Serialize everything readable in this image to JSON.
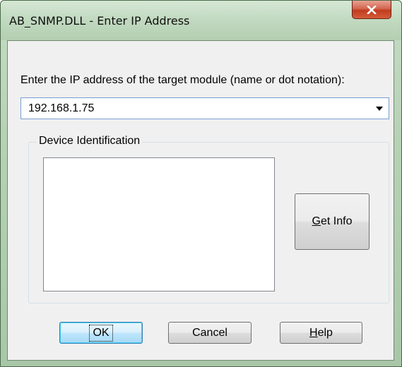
{
  "window": {
    "title": "AB_SNMP.DLL - Enter IP Address"
  },
  "titlebar": {
    "close_icon": "close-x-icon"
  },
  "form": {
    "prompt": "Enter the IP address of the target module (name or dot notation):",
    "ip_value": "192.168.1.75",
    "dropdown_icon": "dropdown-arrow-icon"
  },
  "device_identification": {
    "label": "Device Identification",
    "content": ""
  },
  "buttons": {
    "get_info": {
      "mnemonic": "G",
      "rest": "et Info"
    },
    "ok": "OK",
    "cancel": "Cancel",
    "help": {
      "mnemonic": "H",
      "rest": "elp"
    }
  },
  "colors": {
    "frame": "#b7d1b5",
    "close_button": "#c13c20",
    "default_button_border": "#3c7fb1"
  }
}
